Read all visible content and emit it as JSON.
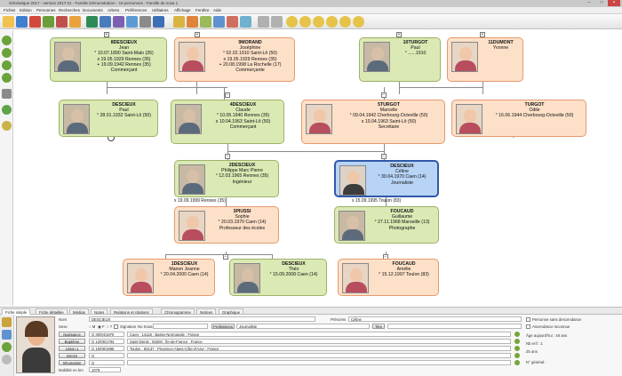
{
  "window": {
    "title": "Généatique 2017 - version 2017.01 - Famille Démonstration - 19 personnes - Famille de sosa 1"
  },
  "menu": [
    "Fichier",
    "Edition",
    "Personnes",
    "Recherches",
    "Documents",
    "Arbres",
    "Préférences",
    "Utilitaires",
    "Affichage",
    "Fenêtre",
    "Aide"
  ],
  "tree": {
    "top_row": [
      {
        "id": "p8",
        "sosa": "8",
        "name": "DESCIEUX",
        "given": "Jean",
        "lines": [
          "° 10.07.1890 Saint-Malo (35)",
          "x 19.05.1929 Rennes (35)",
          "+ 19.09.1942 Rennes (35)"
        ],
        "job": "Commerçant",
        "sex": "m"
      },
      {
        "id": "p9",
        "sosa": "9",
        "name": "MORAND",
        "given": "Joséphine",
        "lines": [
          "° 02.02.1910 Saint-Lô (50)",
          "x 19.05.1929 Rennes (35)",
          "+ 20.08.1998 La Rochelle (17)"
        ],
        "job": "Commerçante",
        "sex": "f"
      },
      {
        "id": "p10",
        "sosa": "10",
        "name": "TURGOT",
        "given": "Paul",
        "lines": [
          "° ......1910"
        ],
        "job": "",
        "sex": "m"
      },
      {
        "id": "p11",
        "sosa": "11",
        "name": "DUMONT",
        "given": "Yvonne",
        "lines": [],
        "job": "",
        "sex": "f"
      }
    ],
    "row2": [
      {
        "id": "paul",
        "sosa": "",
        "name": "DESCIEUX",
        "given": "Paul",
        "lines": [
          "° 28.01.1932 Saint-Lô (50)"
        ],
        "job": "",
        "sex": "m"
      },
      {
        "id": "p4",
        "sosa": "4",
        "name": "DESCIEUX",
        "given": "Claude",
        "lines": [
          "° 10.05.1940 Rennes (35)",
          "x 10.04.1963 Saint-Lô (50)"
        ],
        "job": "Commerçant",
        "sex": "m"
      },
      {
        "id": "p5",
        "sosa": "5",
        "name": "TURGOT",
        "given": "Marcelle",
        "lines": [
          "° 09.04.1942 Cherbourg-Octeville (50)",
          "x 10.04.1963 Saint-Lô (50)"
        ],
        "job": "Secrétaire",
        "sex": "f"
      },
      {
        "id": "odile",
        "sosa": "",
        "name": "TURGOT",
        "given": "Odile",
        "lines": [
          "° 16.06.1944 Cherbourg-Octeville (50)"
        ],
        "job": "",
        "sex": "f"
      }
    ],
    "row3": [
      {
        "id": "p2",
        "sosa": "2",
        "name": "DESCIEUX",
        "given": "Philippe Marc Pierre",
        "lines": [
          "° 12.03.1965 Rennes (35)"
        ],
        "job": "Ingénieur",
        "sex": "m"
      },
      {
        "id": "celine",
        "sosa": "",
        "name": "DESCIEUX",
        "given": "Céline",
        "lines": [
          "° 30.04.1970 Caen (14)"
        ],
        "job": "Journaliste",
        "sex": "sel"
      }
    ],
    "marriage_a": "x 19.09.1999 Rennes (35)",
    "marriage_b": "x 15.09.1995 Toulon (83)",
    "row4": [
      {
        "id": "p3",
        "sosa": "3",
        "name": "PIUSSI",
        "given": "Sophie",
        "lines": [
          "° 20.03.1970 Caen (14)"
        ],
        "job": "Professeur des écoles",
        "sex": "f"
      },
      {
        "id": "foucaud",
        "sosa": "",
        "name": "FOUCAUD",
        "given": "Guillaume",
        "lines": [
          "° 27.11.1968 Marseille (13)"
        ],
        "job": "Photographe",
        "sex": "m"
      }
    ],
    "row5": [
      {
        "id": "p1",
        "sosa": "1",
        "name": "DESCIEUX",
        "given": "Manon Jeanne",
        "lines": [
          "° 20.04.2000 Caen (14)"
        ],
        "job": "",
        "sex": "f"
      },
      {
        "id": "theo",
        "sosa": "",
        "name": "DESCIEUX",
        "given": "Théo",
        "lines": [
          "° 15.09.2008 Caen (14)"
        ],
        "job": "",
        "sex": "m"
      },
      {
        "id": "amelie",
        "sosa": "",
        "name": "FOUCAUD",
        "given": "Amélie",
        "lines": [
          "° 15.12.1997 Toulon (83)"
        ],
        "job": "",
        "sex": "f"
      }
    ]
  },
  "tabs": [
    "Fiche simple",
    "Fiche détaillée",
    "Médias",
    "Notes",
    "Relations et citations",
    "Chronogramme",
    "Notices",
    "Graphique"
  ],
  "form": {
    "nom_label": "Nom",
    "nom_value": "DESCIEUX",
    "prenoms_label": "Prénoms",
    "prenoms_value": "Céline",
    "sexe_label": "Sexe",
    "sexe_opts": [
      "M",
      "F",
      "?"
    ],
    "signature_label": "Signature",
    "no_sosa_label": "No Sosa",
    "profession_btn": "Professions",
    "profession_value": "Journaliste",
    "titre_btn": "Titre",
    "events": [
      {
        "btn": "Naissance",
        "date": "G 30/04/1970",
        "place": "Caen ; 14118 ; Basse-Normandie ; France"
      },
      {
        "btn": "Baptême",
        "date": "G 12/05/1794",
        "place": "Saint-Denis ; 93200 ; Île-de-France ; France"
      },
      {
        "btn": "Union 1",
        "date": "G 15/09/1995",
        "place": "Toulon ; 83137 ; Provence-Alpes-Côte-d'Azur ; France"
      },
      {
        "btn": "Décès",
        "date": "G",
        "place": ""
      },
      {
        "btn": "Inhumation",
        "date": "G",
        "place": ""
      }
    ],
    "mobilite_label": "Mobilité en km",
    "mobilite_value": "1079",
    "right": [
      "Personne sans descendance",
      "Ascendance inconnue",
      "Âge aujourd'hui : 46 ans",
      "Nb enf : 1",
      "25 ans",
      "N° général : "
    ]
  },
  "colors": {
    "male": "#dbe9b4",
    "female": "#fde0c8",
    "selected": "#b7d3f5"
  }
}
